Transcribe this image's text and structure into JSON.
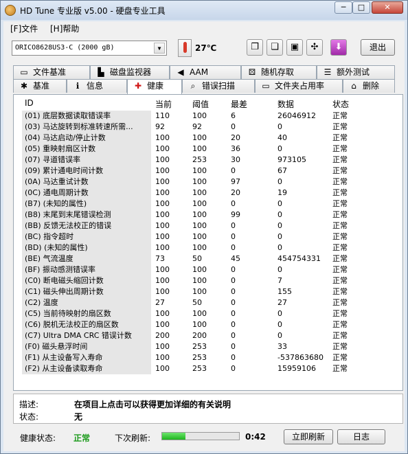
{
  "window": {
    "title": "HD Tune 专业版 v5.00 - 硬盘专业工具",
    "min": "─",
    "max": "□",
    "close": "✕"
  },
  "menu": [
    "[F]文件",
    "[H]帮助"
  ],
  "toolbar": {
    "drive": "ORICO8628US3-C (2000 gB)",
    "temperature": "27℃",
    "exit_label": "退出"
  },
  "tabs_top": [
    {
      "label": "文件基准",
      "icon": "monitor-icon"
    },
    {
      "label": "磁盘监视器",
      "icon": "bar-chart-icon"
    },
    {
      "label": "AAM",
      "icon": "speaker-icon"
    },
    {
      "label": "随机存取",
      "icon": "dice-icon"
    },
    {
      "label": "额外测试",
      "icon": "list-icon"
    }
  ],
  "tabs_bottom": [
    {
      "label": "基准",
      "icon": "lightbulb-icon"
    },
    {
      "label": "信息",
      "icon": "info-icon"
    },
    {
      "label": "健康",
      "icon": "red-cross-icon",
      "active": true
    },
    {
      "label": "错误扫描",
      "icon": "magnifier-icon"
    },
    {
      "label": "文件夹占用率",
      "icon": "folder-icon"
    },
    {
      "label": "删除",
      "icon": "trash-icon"
    }
  ],
  "table": {
    "headers": {
      "id": "ID",
      "current": "当前",
      "threshold": "阈值",
      "worst": "最差",
      "data": "数据",
      "status": "状态"
    },
    "rows": [
      {
        "id": "(01) 底层数据读取错误率",
        "current": "110",
        "threshold": "100",
        "worst": "6",
        "data": "26046912",
        "status": "正常"
      },
      {
        "id": "(03) 马达旋转到标准转速所需...",
        "current": "92",
        "threshold": "92",
        "worst": "0",
        "data": "0",
        "status": "正常"
      },
      {
        "id": "(04) 马达启动/停止计数",
        "current": "100",
        "threshold": "100",
        "worst": "20",
        "data": "40",
        "status": "正常"
      },
      {
        "id": "(05) 重映射扇区计数",
        "current": "100",
        "threshold": "100",
        "worst": "36",
        "data": "0",
        "status": "正常"
      },
      {
        "id": "(07) 寻道错误率",
        "current": "100",
        "threshold": "253",
        "worst": "30",
        "data": "973105",
        "status": "正常"
      },
      {
        "id": "(09) 累计通电时间计数",
        "current": "100",
        "threshold": "100",
        "worst": "0",
        "data": "67",
        "status": "正常"
      },
      {
        "id": "(0A) 马达重试计数",
        "current": "100",
        "threshold": "100",
        "worst": "97",
        "data": "0",
        "status": "正常"
      },
      {
        "id": "(0C) 通电周期计数",
        "current": "100",
        "threshold": "100",
        "worst": "20",
        "data": "19",
        "status": "正常"
      },
      {
        "id": "(B7) (未知的属性)",
        "current": "100",
        "threshold": "100",
        "worst": "0",
        "data": "0",
        "status": "正常"
      },
      {
        "id": "(B8) 末尾到末尾错误检测",
        "current": "100",
        "threshold": "100",
        "worst": "99",
        "data": "0",
        "status": "正常"
      },
      {
        "id": "(BB) 反馈无法校正的错误",
        "current": "100",
        "threshold": "100",
        "worst": "0",
        "data": "0",
        "status": "正常"
      },
      {
        "id": "(BC) 指令超时",
        "current": "100",
        "threshold": "100",
        "worst": "0",
        "data": "0",
        "status": "正常"
      },
      {
        "id": "(BD) (未知的属性)",
        "current": "100",
        "threshold": "100",
        "worst": "0",
        "data": "0",
        "status": "正常"
      },
      {
        "id": "(BE) 气流温度",
        "current": "73",
        "threshold": "50",
        "worst": "45",
        "data": "454754331",
        "status": "正常"
      },
      {
        "id": "(BF) 振动感测错误率",
        "current": "100",
        "threshold": "100",
        "worst": "0",
        "data": "0",
        "status": "正常"
      },
      {
        "id": "(C0) 断电磁头缩回计数",
        "current": "100",
        "threshold": "100",
        "worst": "0",
        "data": "7",
        "status": "正常"
      },
      {
        "id": "(C1) 磁头伸出周期计数",
        "current": "100",
        "threshold": "100",
        "worst": "0",
        "data": "155",
        "status": "正常"
      },
      {
        "id": "(C2) 温度",
        "current": "27",
        "threshold": "50",
        "worst": "0",
        "data": "27",
        "status": "正常"
      },
      {
        "id": "(C5) 当前待映射的扇区数",
        "current": "100",
        "threshold": "100",
        "worst": "0",
        "data": "0",
        "status": "正常"
      },
      {
        "id": "(C6) 脱机无法校正的扇区数",
        "current": "100",
        "threshold": "100",
        "worst": "0",
        "data": "0",
        "status": "正常"
      },
      {
        "id": "(C7) Ultra DMA CRC 错误计数",
        "current": "200",
        "threshold": "200",
        "worst": "0",
        "data": "0",
        "status": "正常"
      },
      {
        "id": "(F0) 磁头悬浮时间",
        "current": "100",
        "threshold": "253",
        "worst": "0",
        "data": "33",
        "status": "正常"
      },
      {
        "id": "(F1) 从主设备写入寿命",
        "current": "100",
        "threshold": "253",
        "worst": "0",
        "data": "-537863680",
        "status": "正常"
      },
      {
        "id": "(F2) 从主设备读取寿命",
        "current": "100",
        "threshold": "253",
        "worst": "0",
        "data": "15959106",
        "status": "正常"
      }
    ]
  },
  "description": {
    "label": "描述:",
    "value": "在项目上点击可以获得更加详细的有关说明"
  },
  "state": {
    "label": "状态:",
    "value": "无"
  },
  "statusbar": {
    "health_label": "健康状态:",
    "health_value": "正常",
    "refresh_label": "下次刷新:",
    "refresh_progress": 0.3,
    "refresh_time": "0:42",
    "refresh_button": "立即刷新",
    "log_button": "日志"
  }
}
